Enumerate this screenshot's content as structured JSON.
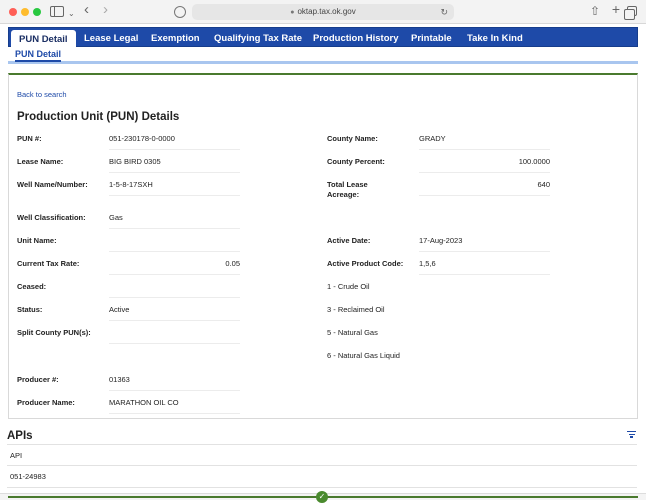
{
  "browser": {
    "url": "oktap.tax.ok.gov"
  },
  "nav": {
    "tabs": [
      "PUN Detail",
      "Lease Legal",
      "Exemption",
      "Qualifying Tax Rate",
      "Production History",
      "Printable",
      "Take In Kind"
    ],
    "sub_tab": "PUN Detail"
  },
  "back_link": "Back to search",
  "section_title": "Production Unit (PUN) Details",
  "fields": {
    "pun": {
      "label": "PUN #:",
      "value": "051-230178-0-0000"
    },
    "lease_name": {
      "label": "Lease Name:",
      "value": "BIG BIRD 0305"
    },
    "well_name": {
      "label": "Well Name/Number:",
      "value": "1-5-8-17SXH"
    },
    "well_class": {
      "label": "Well Classification:",
      "value": "Gas"
    },
    "unit_name": {
      "label": "Unit Name:",
      "value": ""
    },
    "tax_rate": {
      "label": "Current Tax Rate:",
      "value": "0.05"
    },
    "ceased": {
      "label": "Ceased:",
      "value": ""
    },
    "status": {
      "label": "Status:",
      "value": "Active"
    },
    "split_county": {
      "label": "Split County PUN(s):",
      "value": ""
    },
    "producer_num": {
      "label": "Producer #:",
      "value": "01363"
    },
    "producer_name": {
      "label": "Producer Name:",
      "value": "MARATHON OIL CO"
    },
    "county_name": {
      "label": "County Name:",
      "value": "GRADY"
    },
    "county_pct": {
      "label": "County Percent:",
      "value": "100.0000"
    },
    "total_lease_1": "Total Lease",
    "total_lease_2": "Acreage:",
    "total_lease_val": "640",
    "active_date": {
      "label": "Active Date:",
      "value": "17-Aug-2023"
    },
    "active_product": {
      "label": "Active Product Code:",
      "value": "1,5,6"
    }
  },
  "product_codes": [
    "1 - Crude Oil",
    "3 - Reclaimed Oil",
    "5 - Natural Gas",
    "6 - Natural Gas Liquid"
  ],
  "apis": {
    "title": "APIs",
    "header": "API",
    "rows": [
      "051-24983"
    ]
  }
}
